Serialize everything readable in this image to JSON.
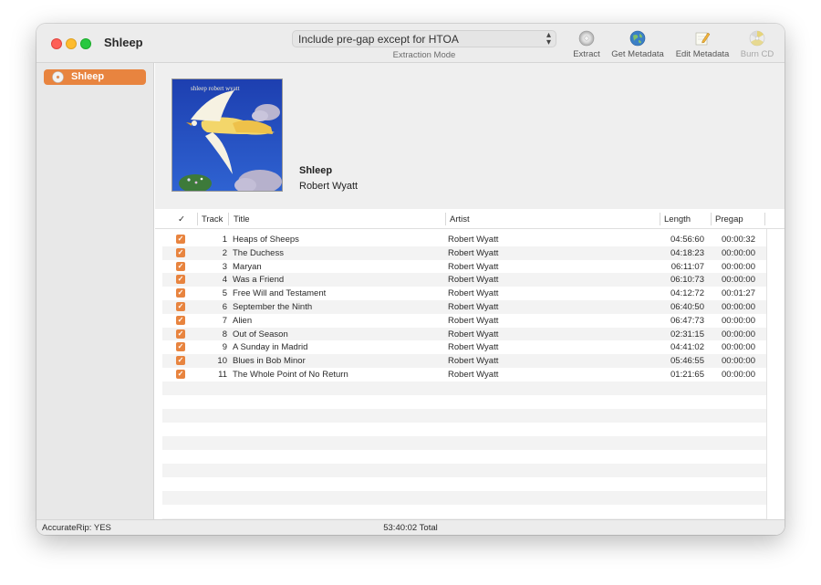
{
  "window": {
    "title": "Shleep"
  },
  "toolbar": {
    "extraction_mode": {
      "selected": "Include pre-gap except for HTOA",
      "label": "Extraction Mode"
    },
    "extract_label": "Extract",
    "get_metadata_label": "Get Metadata",
    "edit_metadata_label": "Edit Metadata",
    "burn_cd_label": "Burn CD",
    "icons": [
      "cd-icon",
      "globe-icon",
      "pencil-icon",
      "burn-icon"
    ]
  },
  "sidebar": {
    "items": [
      {
        "label": "Shleep",
        "icon": "cd-icon",
        "selected": true
      }
    ]
  },
  "album": {
    "title": "Shleep",
    "artist": "Robert Wyatt",
    "cover_text": "shleep robert wyatt"
  },
  "table": {
    "columns": {
      "check": "✓",
      "track": "Track",
      "title": "Title",
      "artist": "Artist",
      "length": "Length",
      "pregap": "Pregap"
    },
    "rows": [
      {
        "track": "1",
        "title": "Heaps of Sheeps",
        "artist": "Robert Wyatt",
        "length": "04:56:60",
        "pregap": "00:00:32"
      },
      {
        "track": "2",
        "title": "The Duchess",
        "artist": "Robert Wyatt",
        "length": "04:18:23",
        "pregap": "00:00:00"
      },
      {
        "track": "3",
        "title": "Maryan",
        "artist": "Robert Wyatt",
        "length": "06:11:07",
        "pregap": "00:00:00"
      },
      {
        "track": "4",
        "title": "Was a Friend",
        "artist": "Robert Wyatt",
        "length": "06:10:73",
        "pregap": "00:00:00"
      },
      {
        "track": "5",
        "title": "Free Will and Testament",
        "artist": "Robert Wyatt",
        "length": "04:12:72",
        "pregap": "00:01:27"
      },
      {
        "track": "6",
        "title": "September the Ninth",
        "artist": "Robert Wyatt",
        "length": "06:40:50",
        "pregap": "00:00:00"
      },
      {
        "track": "7",
        "title": "Alien",
        "artist": "Robert Wyatt",
        "length": "06:47:73",
        "pregap": "00:00:00"
      },
      {
        "track": "8",
        "title": "Out of Season",
        "artist": "Robert Wyatt",
        "length": "02:31:15",
        "pregap": "00:00:00"
      },
      {
        "track": "9",
        "title": "A Sunday in Madrid",
        "artist": "Robert Wyatt",
        "length": "04:41:02",
        "pregap": "00:00:00"
      },
      {
        "track": "10",
        "title": "Blues in Bob Minor",
        "artist": "Robert Wyatt",
        "length": "05:46:55",
        "pregap": "00:00:00"
      },
      {
        "track": "11",
        "title": "The Whole Point of No Return",
        "artist": "Robert Wyatt",
        "length": "01:21:65",
        "pregap": "00:00:00"
      }
    ]
  },
  "status": {
    "accuraterip": "AccurateRip:  YES",
    "total": "53:40:02 Total"
  },
  "colors": {
    "accent": "#e8843f"
  }
}
